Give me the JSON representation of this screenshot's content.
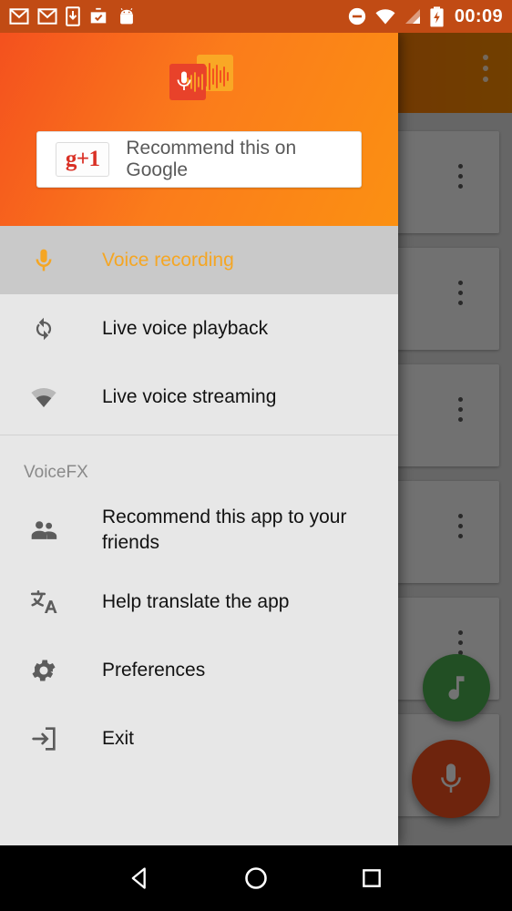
{
  "status_bar": {
    "time": "00:09",
    "left_icons": [
      "gmail-icon",
      "gmail-icon",
      "download-icon",
      "briefcase-check-icon",
      "android-icon"
    ],
    "right_icons": [
      "do-not-disturb-icon",
      "wifi-icon",
      "cell-signal-icon",
      "battery-charging-icon"
    ],
    "background_color": "#c14b14"
  },
  "drawer": {
    "header": {
      "logo_name": "voicefx-app-logo",
      "gradient_from": "#f4511e",
      "gradient_to": "#fb9012",
      "gplus": {
        "badge": "g+1",
        "label": "Recommend this on Google"
      }
    },
    "primary_items": [
      {
        "label": "Voice recording",
        "icon": "microphone-icon",
        "selected": true
      },
      {
        "label": "Live voice playback",
        "icon": "loop-sync-icon",
        "selected": false
      },
      {
        "label": "Live voice streaming",
        "icon": "wifi-icon",
        "selected": false
      }
    ],
    "section_title": "VoiceFX",
    "secondary_items": [
      {
        "label": "Recommend this app to your friends",
        "icon": "people-icon"
      },
      {
        "label": "Help translate the app",
        "icon": "translate-icon"
      },
      {
        "label": "Preferences",
        "icon": "gear-icon"
      },
      {
        "label": "Exit",
        "icon": "exit-icon"
      }
    ],
    "selected_color": "#f5a623",
    "selected_row_bg": "#c9c9c9",
    "background_color": "#e7e7e7"
  },
  "background_app": {
    "toolbar_overflow": "overflow-menu-icon",
    "card_count": 6,
    "card_overflow": "overflow-menu-icon",
    "fabs": [
      {
        "name": "music-fab",
        "icon": "music-note-icon",
        "color": "#4caf50"
      },
      {
        "name": "record-fab",
        "icon": "microphone-icon",
        "color": "#f4511e"
      }
    ]
  },
  "nav_bar": {
    "buttons": [
      {
        "name": "back-button",
        "icon": "triangle-back-icon"
      },
      {
        "name": "home-button",
        "icon": "circle-home-icon"
      },
      {
        "name": "recents-button",
        "icon": "square-recents-icon"
      }
    ]
  }
}
